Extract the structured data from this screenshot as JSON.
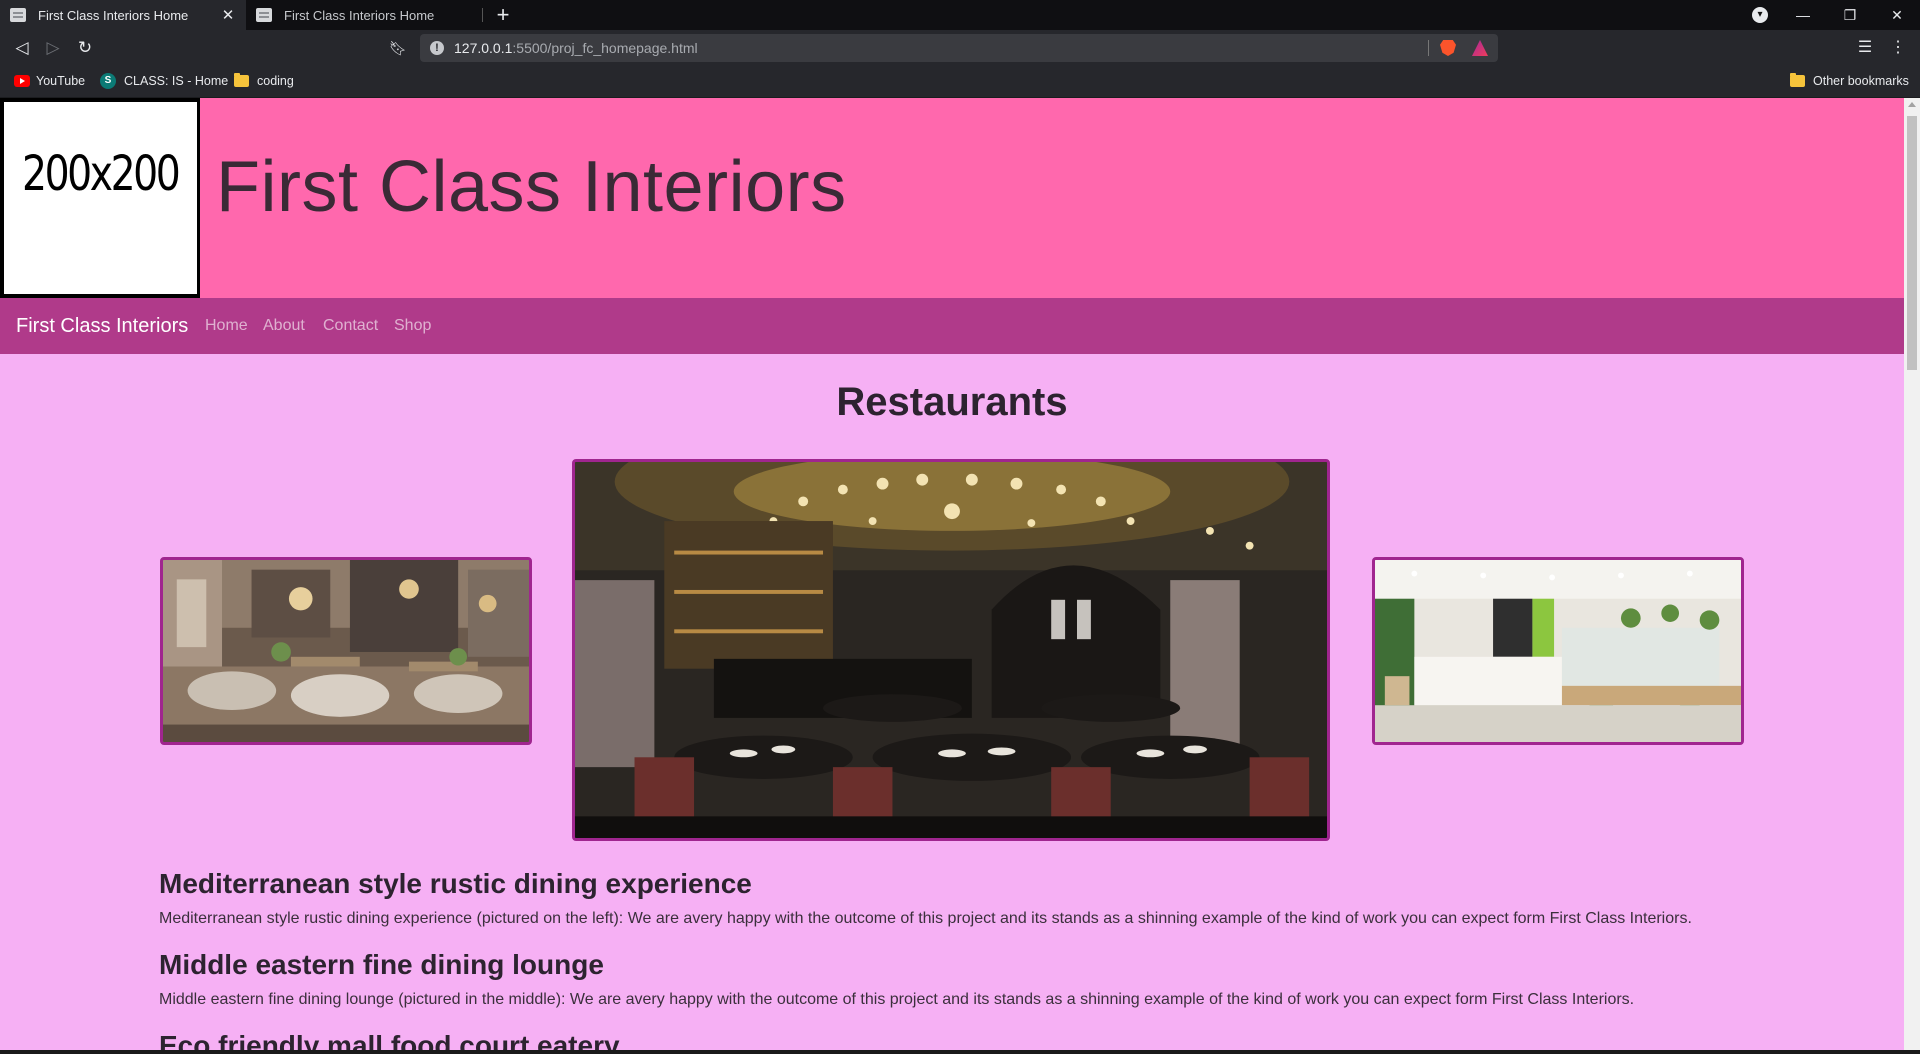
{
  "browser": {
    "tabs": [
      {
        "title": "First Class Interiors Home",
        "active": true
      },
      {
        "title": "First Class Interiors Home",
        "active": false
      }
    ],
    "close_symbol": "✕",
    "new_tab_symbol": "+",
    "url_host": "127.0.0.1",
    "url_rest": ":5500/proj_fc_homepage.html",
    "bookmarks": [
      {
        "label": "YouTube",
        "icon": "youtube-icon"
      },
      {
        "label": "CLASS: IS - Home",
        "icon": "class-icon"
      },
      {
        "label": "coding",
        "icon": "folder-icon"
      }
    ],
    "other_bookmarks": "Other bookmarks",
    "accent": "#26272c"
  },
  "site": {
    "logo_text": "200x200",
    "title": "First Class Interiors",
    "header_color": "#ff68ad",
    "nav_color": "#b03a8a",
    "body_color": "#f6b0f4",
    "nav": {
      "brand": "First Class Interiors",
      "links": [
        "Home",
        "About",
        "Contact",
        "Shop"
      ]
    },
    "heading": "Restaurants",
    "projects": [
      {
        "title": "Mediterranean style rustic dining experience",
        "desc": "Mediterranean style rustic dining experience (pictured on the left): We are avery happy with the outcome of this project and its stands as a shinning example of the kind of work you can expect form First Class Interiors."
      },
      {
        "title": "Middle eastern fine dining lounge",
        "desc": "Middle eastern fine dining lounge (pictured in the middle): We are avery happy with the outcome of this project and its stands as a shinning example of the kind of work you can expect form First Class Interiors."
      },
      {
        "title": "Eco friendly mall food court eatery",
        "desc": ""
      }
    ]
  }
}
